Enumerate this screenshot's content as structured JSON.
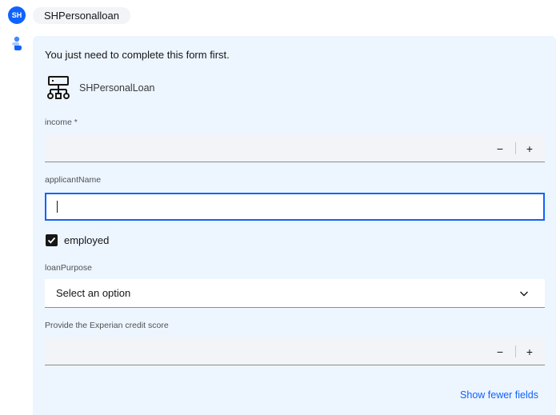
{
  "user": {
    "avatar_initials": "SH",
    "message": "SHPersonalloan"
  },
  "bot": {
    "intro": "You just need to complete this form first.",
    "flow_name": "SHPersonalLoan"
  },
  "form": {
    "income_label": "income *",
    "income_value": "",
    "applicant_name_label": "applicantName",
    "applicant_name_value": "",
    "employed_label": "employed",
    "employed_checked": true,
    "loan_purpose_label": "loanPurpose",
    "loan_purpose_value": "Select an option",
    "credit_score_label": "Provide the Experian credit score",
    "credit_score_value": "",
    "decrement_symbol": "−",
    "increment_symbol": "+",
    "show_fewer_label": "Show fewer fields"
  },
  "colors": {
    "accent": "#0f62fe",
    "bubble_bg": "#edf5ff",
    "field_bg": "#f2f4f8"
  }
}
